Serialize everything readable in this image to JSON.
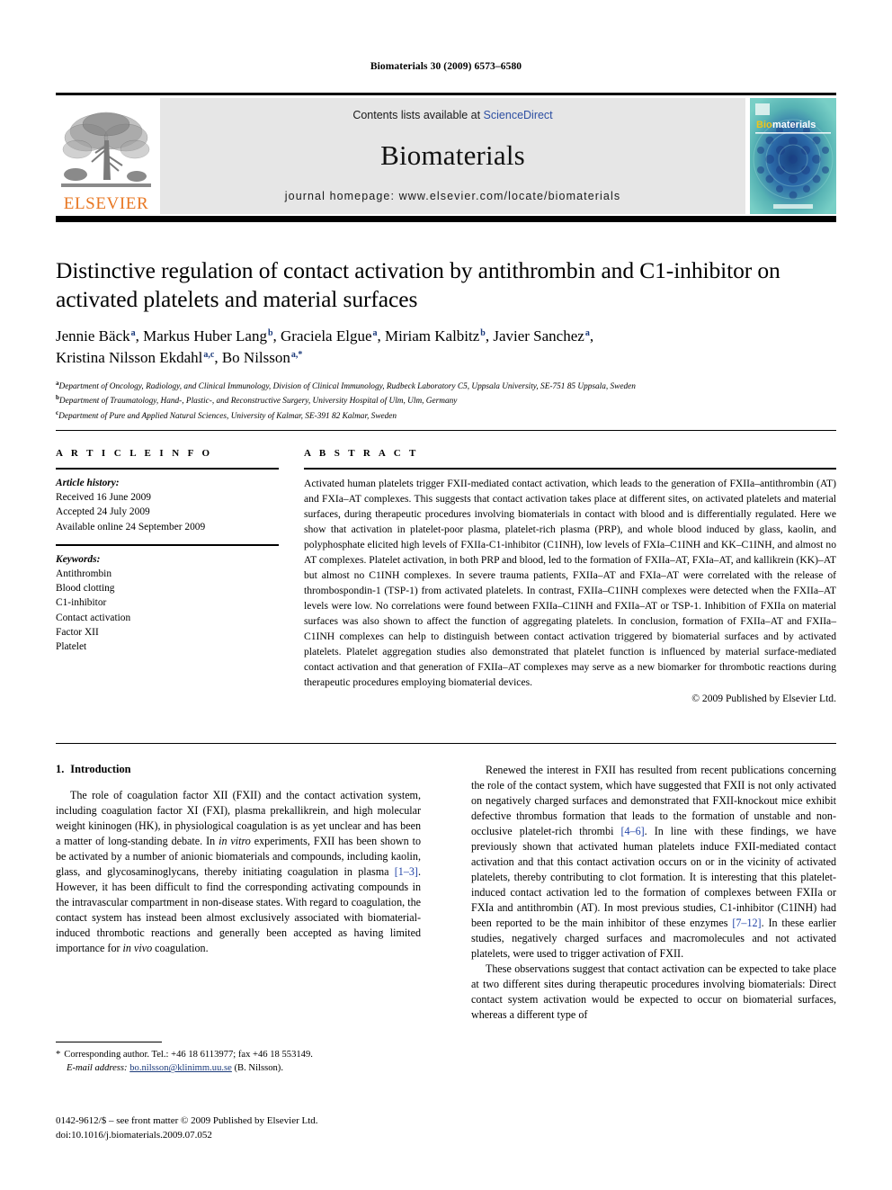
{
  "running_head": "Biomaterials 30 (2009) 6573–6580",
  "masthead": {
    "publisher_name": "ELSEVIER",
    "contents_prefix": "Contents lists available at ",
    "sciencedirect": "ScienceDirect",
    "journal_title": "Biomaterials",
    "journal_homepage": "journal homepage: www.elsevier.com/locate/biomaterials",
    "cover_label_bio": "Bio",
    "cover_label_materials": "materials",
    "accent_orange": "#E87722",
    "link_blue": "#2d4fa2",
    "band_gray": "#e6e6e6",
    "cover_teal": "#5fb9b6"
  },
  "article": {
    "title": "Distinctive regulation of contact activation by antithrombin and C1-inhibitor on activated platelets and material surfaces",
    "authors_line_1": "Jennie Bäck a, Markus Huber Lang b, Graciela Elgue a, Miriam Kalbitz b, Javier Sanchez a,",
    "authors_line_2": "Kristina Nilsson Ekdahl a,c, Bo Nilsson a,*",
    "authors": [
      {
        "name": "Jennie Bäck",
        "sup": "a",
        "sep": ", "
      },
      {
        "name": "Markus Huber Lang",
        "sup": "b",
        "sep": ", "
      },
      {
        "name": "Graciela Elgue",
        "sup": "a",
        "sep": ", "
      },
      {
        "name": "Miriam Kalbitz",
        "sup": "b",
        "sep": ", "
      },
      {
        "name": "Javier Sanchez",
        "sup": "a",
        "sep": ","
      },
      {
        "name": "Kristina Nilsson Ekdahl",
        "sup": "a,c",
        "sep": ", "
      },
      {
        "name": "Bo Nilsson",
        "sup": "a,*",
        "sep": ""
      }
    ],
    "affiliations": [
      {
        "mark": "a",
        "text": "Department of Oncology, Radiology, and Clinical Immunology, Division of Clinical Immunology, Rudbeck Laboratory C5, Uppsala University, SE-751 85 Uppsala, Sweden"
      },
      {
        "mark": "b",
        "text": "Department of Traumatology, Hand-, Plastic-, and Reconstructive Surgery, University Hospital of Ulm, Ulm, Germany"
      },
      {
        "mark": "c",
        "text": "Department of Pure and Applied Natural Sciences, University of Kalmar, SE-391 82 Kalmar, Sweden"
      }
    ]
  },
  "article_info": {
    "label": "A R T I C L E  I N F O",
    "history_head": "Article history:",
    "history": [
      "Received 16 June 2009",
      "Accepted 24 July 2009",
      "Available online 24 September 2009"
    ],
    "keywords_head": "Keywords:",
    "keywords": [
      "Antithrombin",
      "Blood clotting",
      "C1-inhibitor",
      "Contact activation",
      "Factor XII",
      "Platelet"
    ]
  },
  "abstract": {
    "label": "A B S T R A C T",
    "text": "Activated human platelets trigger FXII-mediated contact activation, which leads to the generation of FXIIa–antithrombin (AT) and FXIa–AT complexes. This suggests that contact activation takes place at different sites, on activated platelets and material surfaces, during therapeutic procedures involving biomaterials in contact with blood and is differentially regulated. Here we show that activation in platelet-poor plasma, platelet-rich plasma (PRP), and whole blood induced by glass, kaolin, and polyphosphate elicited high levels of FXIIa-C1-inhibitor (C1INH), low levels of FXIa–C1INH and KK–C1INH, and almost no AT complexes. Platelet activation, in both PRP and blood, led to the formation of FXIIa–AT, FXIa–AT, and kallikrein (KK)–AT but almost no C1INH complexes. In severe trauma patients, FXIIa–AT and FXIa–AT were correlated with the release of thrombospondin-1 (TSP-1) from activated platelets. In contrast, FXIIa–C1INH complexes were detected when the FXIIa–AT levels were low. No correlations were found between FXIIa–C1INH and FXIIa–AT or TSP-1. Inhibition of FXIIa on material surfaces was also shown to affect the function of aggregating platelets. In conclusion, formation of FXIIa–AT and FXIIa–C1INH complexes can help to distinguish between contact activation triggered by biomaterial surfaces and by activated platelets. Platelet aggregation studies also demonstrated that platelet function is influenced by material surface-mediated contact activation and that generation of FXIIa–AT complexes may serve as a new biomarker for thrombotic reactions during therapeutic procedures employing biomaterial devices.",
    "copyright": "© 2009 Published by Elsevier Ltd."
  },
  "introduction": {
    "number": "1.",
    "heading": "Introduction",
    "paragraph_1_a": "The role of coagulation factor XII (FXII) and the contact activation system, including coagulation factor XI (FXI), plasma prekallikrein, and high molecular weight kininogen (HK), in physiological coagulation is as yet unclear and has been a matter of long-standing debate. In ",
    "paragraph_1_italic": "in vitro",
    "paragraph_1_b": " experiments, FXII has been shown to be activated by a number of anionic biomaterials and compounds, including kaolin, glass, and glycosaminoglycans, thereby initiating coagulation in plasma ",
    "paragraph_1_ref": "[1–3]",
    "paragraph_1_c": ". However, it has been difficult to find the corresponding activating compounds in the intravascular compartment in non-disease states. With regard to coagulation, the contact system has instead been almost exclusively associated with biomaterial-induced thrombotic reactions and generally been accepted as having limited importance for ",
    "paragraph_1_italic2": "in vivo",
    "paragraph_1_d": " coagulation.",
    "paragraph_2_a": "Renewed the interest in FXII has resulted from recent publications concerning the role of the contact system, which have suggested that FXII is not only activated on negatively charged surfaces and demonstrated that FXII-knockout mice exhibit defective thrombus formation that leads to the formation of unstable and non-occlusive platelet-rich thrombi ",
    "paragraph_2_ref1": "[4–6]",
    "paragraph_2_b": ". In line with these findings, we have previously shown that activated human platelets induce FXII-mediated contact activation and that this contact activation occurs on or in the vicinity of activated platelets, thereby contributing to clot formation. It is interesting that this platelet-induced contact activation led to the formation of complexes between FXIIa or FXIa and antithrombin (AT). In most previous studies, C1-inhibitor (C1INH) had been reported to be the main inhibitor of these enzymes ",
    "paragraph_2_ref2": "[7–12]",
    "paragraph_2_c": ". In these earlier studies, negatively charged surfaces and macromolecules and not activated platelets, were used to trigger activation of FXII.",
    "paragraph_3": "These observations suggest that contact activation can be expected to take place at two different sites during therapeutic procedures involving biomaterials: Direct contact system activation would be expected to occur on biomaterial surfaces, whereas a different type of"
  },
  "footnote": {
    "star": "*",
    "corresponding": "Corresponding author. Tel.: +46 18 6113977; fax +46 18 553149.",
    "email_label": "E-mail address:",
    "email": "bo.nilsson@klinimm.uu.se",
    "email_suffix": "(B. Nilsson)."
  },
  "imprint": {
    "line1": "0142-9612/$ – see front matter © 2009 Published by Elsevier Ltd.",
    "line2": "doi:10.1016/j.biomaterials.2009.07.052"
  }
}
